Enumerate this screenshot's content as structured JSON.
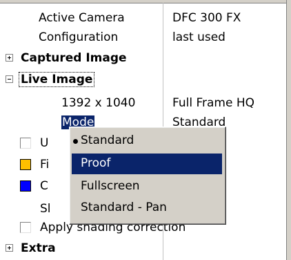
{
  "properties": {
    "active_camera": {
      "label": "Active Camera",
      "value": "DFC 300 FX"
    },
    "configuration": {
      "label": "Configuration",
      "value": "last used"
    },
    "captured_image": {
      "label": "Captured Image"
    },
    "live_image": {
      "label": "Live Image"
    },
    "resolution": {
      "label": "1392 x 1040",
      "value": "Full Frame HQ"
    },
    "mode": {
      "label": "Mode",
      "value": "Standard"
    },
    "u_row": {
      "label": "U"
    },
    "fi_row": {
      "label": "Fi",
      "color": "#ffc000"
    },
    "c_row": {
      "label": "C",
      "color": "#0000ff"
    },
    "sl_row": {
      "label": "Sl"
    },
    "shading": {
      "label": "Apply shading correction"
    },
    "extra": {
      "label": "Extra"
    }
  },
  "context_menu": {
    "items": [
      {
        "label": "Standard",
        "checked": true
      },
      {
        "label": "Proof",
        "highlighted": true
      },
      {
        "label": "Fullscreen"
      },
      {
        "label": "Standard - Pan"
      }
    ]
  },
  "colors": {
    "selection": "#0a246a",
    "menu_bg": "#d4d0c8"
  },
  "icons": [
    "expand-plus-icon",
    "collapse-minus-icon",
    "radio-bullet-icon"
  ]
}
